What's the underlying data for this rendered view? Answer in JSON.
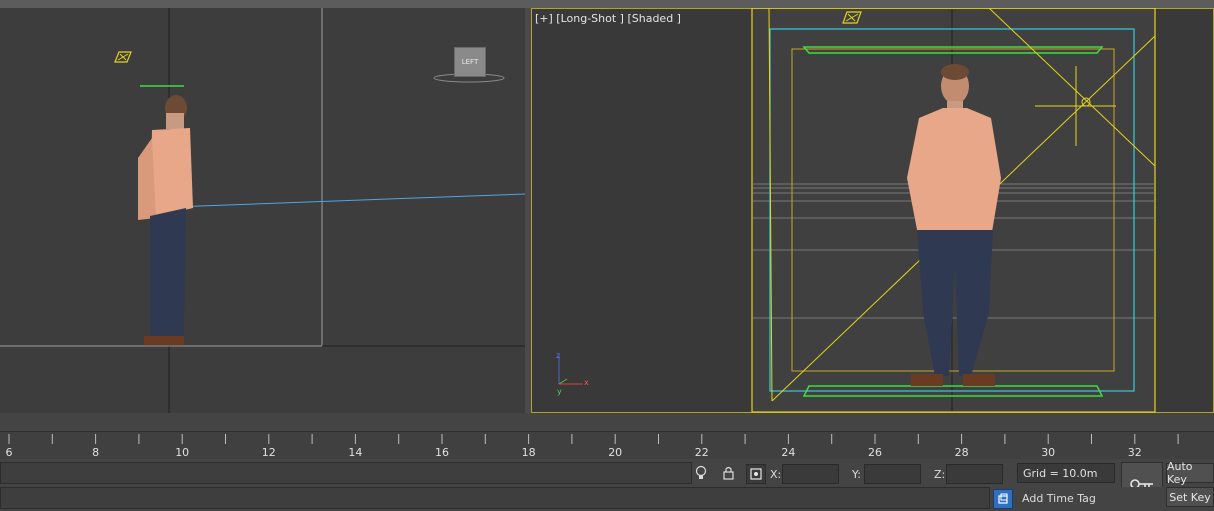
{
  "viewport_right": {
    "label": "[+] [Long-Shot ] [Shaded ]"
  },
  "viewport_left": {
    "viewcube_label": "LEFT"
  },
  "timeline": {
    "tick_labels": [
      "6",
      "8",
      "10",
      "12",
      "14",
      "16",
      "18",
      "20",
      "22",
      "24",
      "26",
      "28",
      "30",
      "32"
    ]
  },
  "coords": {
    "x_label": "X:",
    "y_label": "Y:",
    "z_label": "Z:",
    "x_value": "",
    "y_value": "",
    "z_value": ""
  },
  "grid": {
    "label": "Grid = 10.0m"
  },
  "buttons": {
    "auto_key": "Auto Key",
    "set_key": "Set Key",
    "add_time_tag": "Add Time Tag"
  },
  "colors": {
    "viewport_border_active": "#b3a32c",
    "camera_yellow": "#e6d31c",
    "safe_frame_cyan": "#2fd0e0",
    "safe_frame_green": "#3dde3d",
    "ground_blue": "#4aa7e6"
  }
}
